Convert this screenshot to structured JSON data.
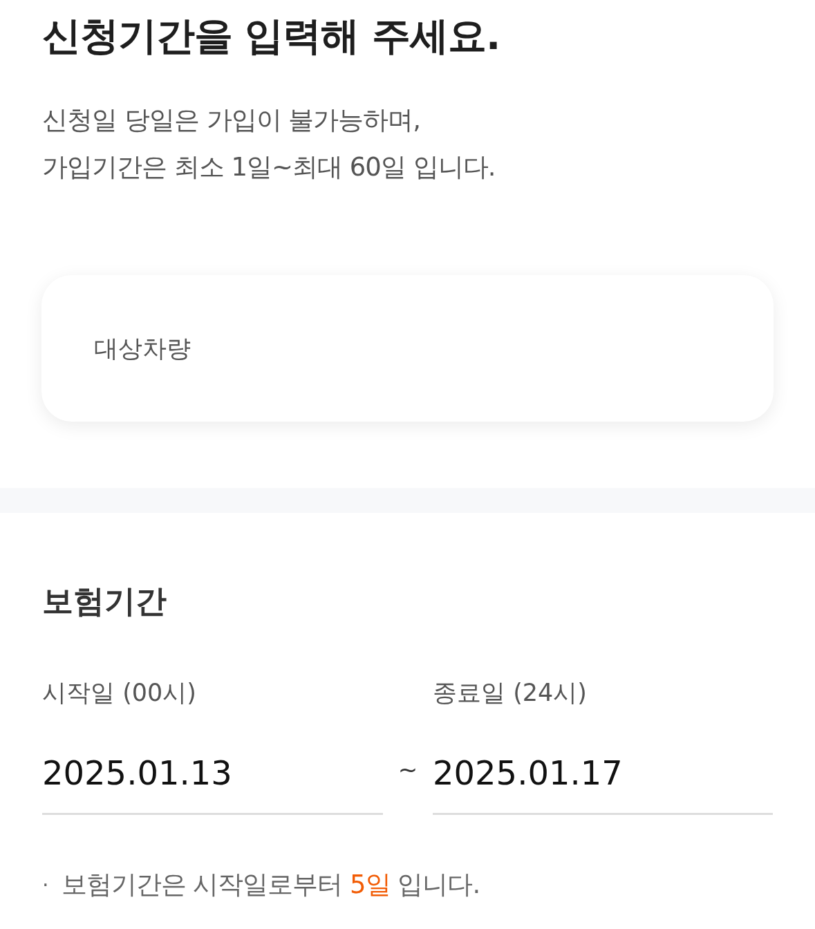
{
  "title": "신청기간을 입력해 주세요.",
  "description": [
    "신청일 당일은 가입이 불가능하며,",
    "가입기간은 최소 1일~최대 60일 입니다."
  ],
  "vehicle_card": {
    "label": "대상차량"
  },
  "period": {
    "heading": "보험기간",
    "start": {
      "label": "시작일 (00시)",
      "value": "2025.01.13"
    },
    "separator": "~",
    "end": {
      "label": "종료일 (24시)",
      "value": "2025.01.17"
    },
    "note": {
      "bullet": "·",
      "prefix": "보험기간은 시작일로부터 ",
      "highlight": "5일",
      "suffix": " 입니다."
    }
  }
}
